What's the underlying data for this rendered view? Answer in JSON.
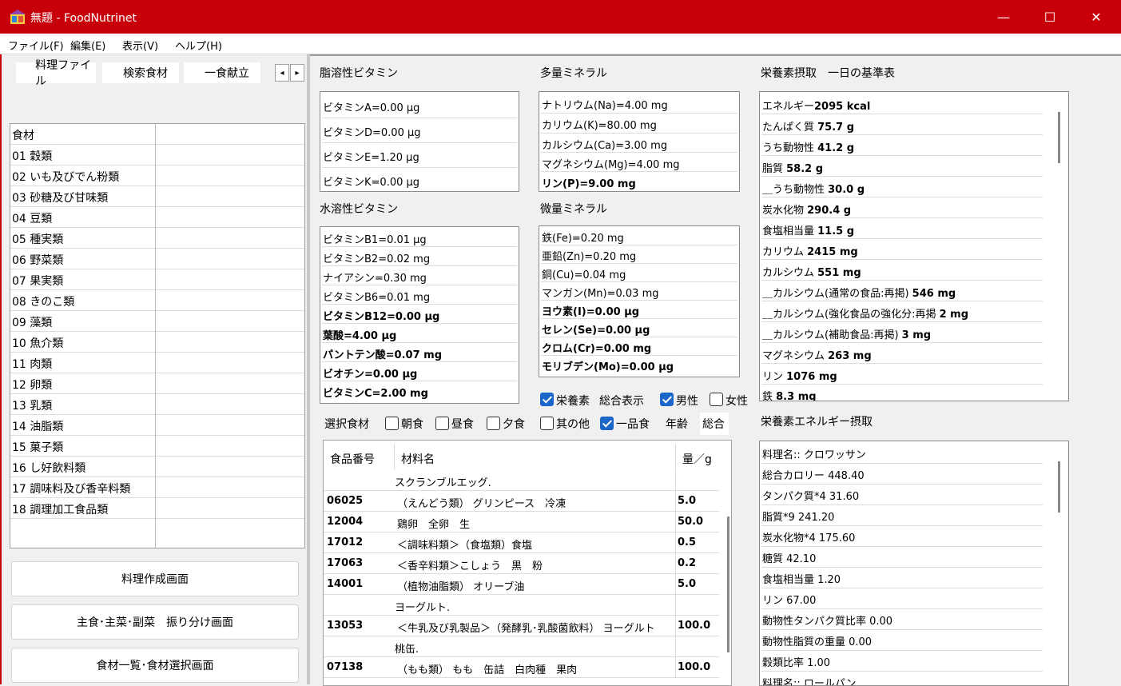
{
  "window": {
    "title": "無題 - FoodNutrinet",
    "minimize_glyph": "—",
    "maximize_glyph": "☐",
    "close_glyph": "✕",
    "brand_color": "#c8000a",
    "app_icon": "app-icon"
  },
  "menu": [
    "ファイル(F)",
    "編集(E)",
    "表示(V)",
    "ヘルプ(H)"
  ],
  "tabs": [
    "料理ファイル",
    "検索食材",
    "一食献立"
  ],
  "tab_scroll": {
    "left": "◂",
    "right": "▸"
  },
  "food_grid": {
    "header": "食材",
    "rows": [
      "01 穀類",
      "02 いも及びでん粉類",
      "03 砂糖及び甘味類",
      "04 豆類",
      "05 種実類",
      "06 野菜類",
      "07 果実類",
      "08 きのこ類",
      "09 藻類",
      "10 魚介類",
      "11 肉類",
      "12 卵類",
      "13 乳類",
      "14 油脂類",
      "15 菓子類",
      "16 し好飲料類",
      "17 調味料及び香辛料類",
      "18 調理加工食品類"
    ]
  },
  "buttons": [
    "料理作成画面",
    "主食･主菜･副菜　振り分け画面",
    "食材一覧･食材選択画面"
  ],
  "fat_vitamins": {
    "label": "脂溶性ビタミン",
    "items": [
      "ビタミンA=0.00 µg",
      "ビタミンD=0.00 µg",
      "ビタミンE=1.20 µg",
      "ビタミンK=0.00 µg"
    ]
  },
  "water_vitamins": {
    "label": "水溶性ビタミン",
    "items": [
      {
        "text": "ビタミンB1=0.01 µg",
        "bold": false
      },
      {
        "text": "ビタミンB2=0.02 mg",
        "bold": false
      },
      {
        "text": "ナイアシン=0.30 mg",
        "bold": false
      },
      {
        "text": "ビタミンB6=0.01 mg",
        "bold": false
      },
      {
        "text": "ビタミンB12=0.00 µg",
        "bold": true
      },
      {
        "text": "葉酸=4.00 µg",
        "bold": true
      },
      {
        "text": "パントテン酸=0.07 mg",
        "bold": true
      },
      {
        "text": "ビオチン=0.00 µg",
        "bold": true
      },
      {
        "text": "ビタミンC=2.00 mg",
        "bold": true
      }
    ]
  },
  "macro_minerals": {
    "label": "多量ミネラル",
    "items": [
      {
        "text": "ナトリウム(Na)=4.00 mg",
        "bold": false
      },
      {
        "text": "カリウム(K)=80.00 mg",
        "bold": false
      },
      {
        "text": "カルシウム(Ca)=3.00 mg",
        "bold": false
      },
      {
        "text": "マグネシウム(Mg)=4.00 mg",
        "bold": false
      },
      {
        "text": "リン(P)=9.00 mg",
        "bold": true
      }
    ]
  },
  "trace_minerals": {
    "label": "微量ミネラル",
    "items": [
      {
        "text": "鉄(Fe)=0.20 mg",
        "bold": false
      },
      {
        "text": "亜鉛(Zn)=0.20 mg",
        "bold": false
      },
      {
        "text": "銅(Cu)=0.04 mg",
        "bold": false
      },
      {
        "text": "マンガン(Mn)=0.03 mg",
        "bold": false
      },
      {
        "text": "ヨウ素(I)=0.00 µg",
        "bold": true
      },
      {
        "text": "セレン(Se)=0.00 µg",
        "bold": true
      },
      {
        "text": "クロム(Cr)=0.00 mg",
        "bold": true
      },
      {
        "text": "モリブデン(Mo)=0.00 µg",
        "bold": true
      }
    ]
  },
  "display_options": {
    "nutrient_label": "栄養素",
    "nutrient_checked": true,
    "total_display": "総合表示",
    "male_label": "男性",
    "male_checked": true,
    "female_label": "女性",
    "female_checked": false
  },
  "selection": {
    "label": "選択食材",
    "breakfast": "朝食",
    "lunch": "昼食",
    "dinner": "夕食",
    "other": "其の他",
    "single": "一品食",
    "single_checked": true,
    "age_label": "年齢",
    "age_value": "総合"
  },
  "daily_standard": {
    "label": "栄養素摂取　一日の基準表",
    "items": [
      {
        "name": "エネルギー",
        "value": "2095 kcal"
      },
      {
        "name": "たんぱく質 ",
        "value": "75.7 g"
      },
      {
        "name": "うち動物性 ",
        "value": "41.2 g"
      },
      {
        "name": "脂質 ",
        "value": "58.2 g"
      },
      {
        "name": "＿うち動物性 ",
        "value": "30.0 g"
      },
      {
        "name": "炭水化物 ",
        "value": "290.4 g"
      },
      {
        "name": "食塩相当量 ",
        "value": "11.5 g"
      },
      {
        "name": "カリウム ",
        "value": "2415 mg"
      },
      {
        "name": "カルシウム ",
        "value": "551 mg"
      },
      {
        "name": "＿カルシウム(通常の食品:再掲) ",
        "value": "546 mg"
      },
      {
        "name": "＿カルシウム(強化食品の強化分:再掲 ",
        "value": "2 mg"
      },
      {
        "name": "＿カルシウム(補助食品:再掲) ",
        "value": "3 mg"
      },
      {
        "name": "マグネシウム ",
        "value": "263 mg"
      },
      {
        "name": "リン ",
        "value": "1076 mg"
      },
      {
        "name": "鉄 ",
        "value": "8.3 mg"
      }
    ]
  },
  "energy_intake": {
    "label": "栄養素エネルギー摂取",
    "items": [
      "料理名:: クロワッサン",
      "総合カロリー 448.40",
      "タンパク質*4 31.60",
      "脂質*9 241.20",
      "炭水化物*4 175.60",
      "糖質 42.10",
      "食塩相当量 1.20",
      "リン 67.00",
      "動物性タンパク質比率 0.00",
      "動物性脂質の重量 0.00",
      "穀類比率 1.00",
      "料理名:: ロールパン"
    ]
  },
  "food_table": {
    "headers": [
      "食品番号",
      "材料名",
      "量／g"
    ],
    "rows": [
      {
        "code": "",
        "name": "スクランブルエッグ.",
        "amount": "",
        "dish": true
      },
      {
        "code": "06025",
        "name": "（えんどう類） グリンピース　冷凍",
        "amount": "5.0",
        "dish": false
      },
      {
        "code": "12004",
        "name": "鶏卵　全卵　生",
        "amount": "50.0",
        "dish": false
      },
      {
        "code": "17012",
        "name": "＜調味料類＞（食塩類）食塩",
        "amount": "0.5",
        "dish": false
      },
      {
        "code": "17063",
        "name": "＜香辛料類＞こしょう　黒　粉",
        "amount": "0.2",
        "dish": false
      },
      {
        "code": "14001",
        "name": "（植物油脂類） オリーブ油",
        "amount": "5.0",
        "dish": false
      },
      {
        "code": "",
        "name": "ヨーグルト.",
        "amount": "",
        "dish": true
      },
      {
        "code": "13053",
        "name": "＜牛乳及び乳製品＞（発酵乳･乳酸菌飲料） ヨーグルト",
        "amount": "100.0",
        "dish": false
      },
      {
        "code": "",
        "name": "桃缶.",
        "amount": "",
        "dish": true
      },
      {
        "code": "07138",
        "name": "（もも類） もも　缶詰　白肉種　果肉",
        "amount": "100.0",
        "dish": false
      }
    ]
  }
}
